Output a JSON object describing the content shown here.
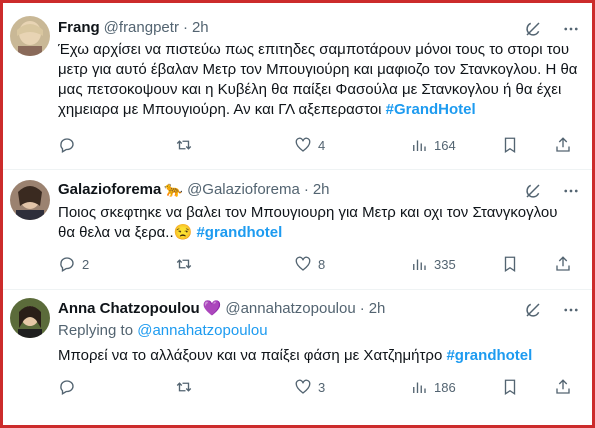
{
  "tweets": [
    {
      "name": "Frang",
      "handle": "@frangpetr",
      "time": "2h",
      "text": "Έχω αρχίσει να πιστεύω πως επιτηδες σαμποτάρουν μόνοι τους το στορι του μετρ για αυτό έβαλαν Μετρ τον Μπουγιούρη και μαφιοζο τον Στανκογλου. Η θα μας πετσοκοψουν και η Κυβέλη θα παίξει Φασούλα με Στανκογλου ή θα έχει χημειαρα με Μπουγιούρη. Αν και ΓΛ αξεπεραστοι",
      "hashtag": "#GrandHotel",
      "replies": "",
      "retweets": "",
      "likes": "4",
      "views": "164"
    },
    {
      "name": "Galazioforema",
      "name_emoji": "🐆",
      "handle": "@Galazioforema",
      "time": "2h",
      "text": "Ποιος σκεφτηκε να βαλει τον Μπουγιουρη για Μετρ και οχι τον Στανγκογλου θα θελα να ξερα..",
      "emoji": "😒",
      "hashtag": "#grandhotel",
      "replies": "2",
      "retweets": "",
      "likes": "8",
      "views": "335"
    },
    {
      "name": "Anna Chatzopoulou",
      "name_emoji": "💜",
      "handle": "@annahatzopoulou",
      "time": "2h",
      "replying_label": "Replying to",
      "replying_handle": "@annahatzopoulou",
      "text": "Μπορεί να το αλλάξουν και να παίξει φάση με Χατζημήτρο",
      "hashtag": "#grandhotel",
      "replies": "",
      "retweets": "",
      "likes": "3",
      "views": "186"
    }
  ],
  "icons": {
    "grok": "grok-icon",
    "more": "more-icon",
    "reply": "reply-icon",
    "retweet": "retweet-icon",
    "like": "like-icon",
    "views": "views-icon",
    "bookmark": "bookmark-icon",
    "share": "share-icon"
  },
  "colors": {
    "accent": "#1d9bf0",
    "muted": "#536471",
    "frame": "#cc2b2b"
  }
}
